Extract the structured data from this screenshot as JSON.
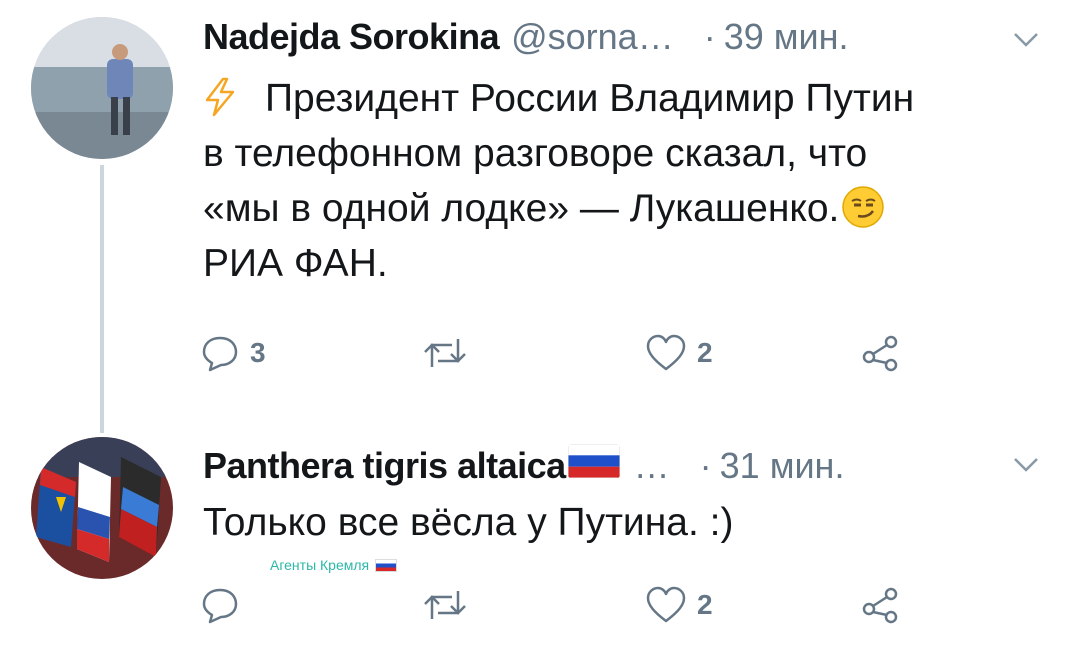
{
  "tweets": [
    {
      "author": "Nadejda Sorokina",
      "handle": "@sorna…",
      "dot": "·",
      "time": "39 мин.",
      "lines": [
        "Президент России Владимир Путин",
        "в телефонном разговоре сказал, что",
        "«мы в одной лодке» — Лукашенко.",
        "РИА ФАН."
      ],
      "icons": {
        "prefix": "high-voltage-emoji",
        "suffix": "smirking-face-emoji"
      },
      "actions": {
        "reply_count": "3",
        "retweet_count": "",
        "like_count": "2"
      }
    },
    {
      "author": "Panthera tigris altaica",
      "handle": "…",
      "dot": "·",
      "time": "31 мин.",
      "lines": [
        "Только все вёсла у Путина. :)"
      ],
      "icons": {
        "name_suffix": "russia-flag-emoji"
      },
      "actions": {
        "reply_count": "",
        "retweet_count": "",
        "like_count": "2"
      }
    }
  ],
  "watermark": "Агенты Кремля",
  "colors": {
    "text": "#14171a",
    "secondary": "#657786",
    "thread_line": "#ccd6dd",
    "watermark": "#2cb8a8",
    "zap": "#f5a623"
  }
}
